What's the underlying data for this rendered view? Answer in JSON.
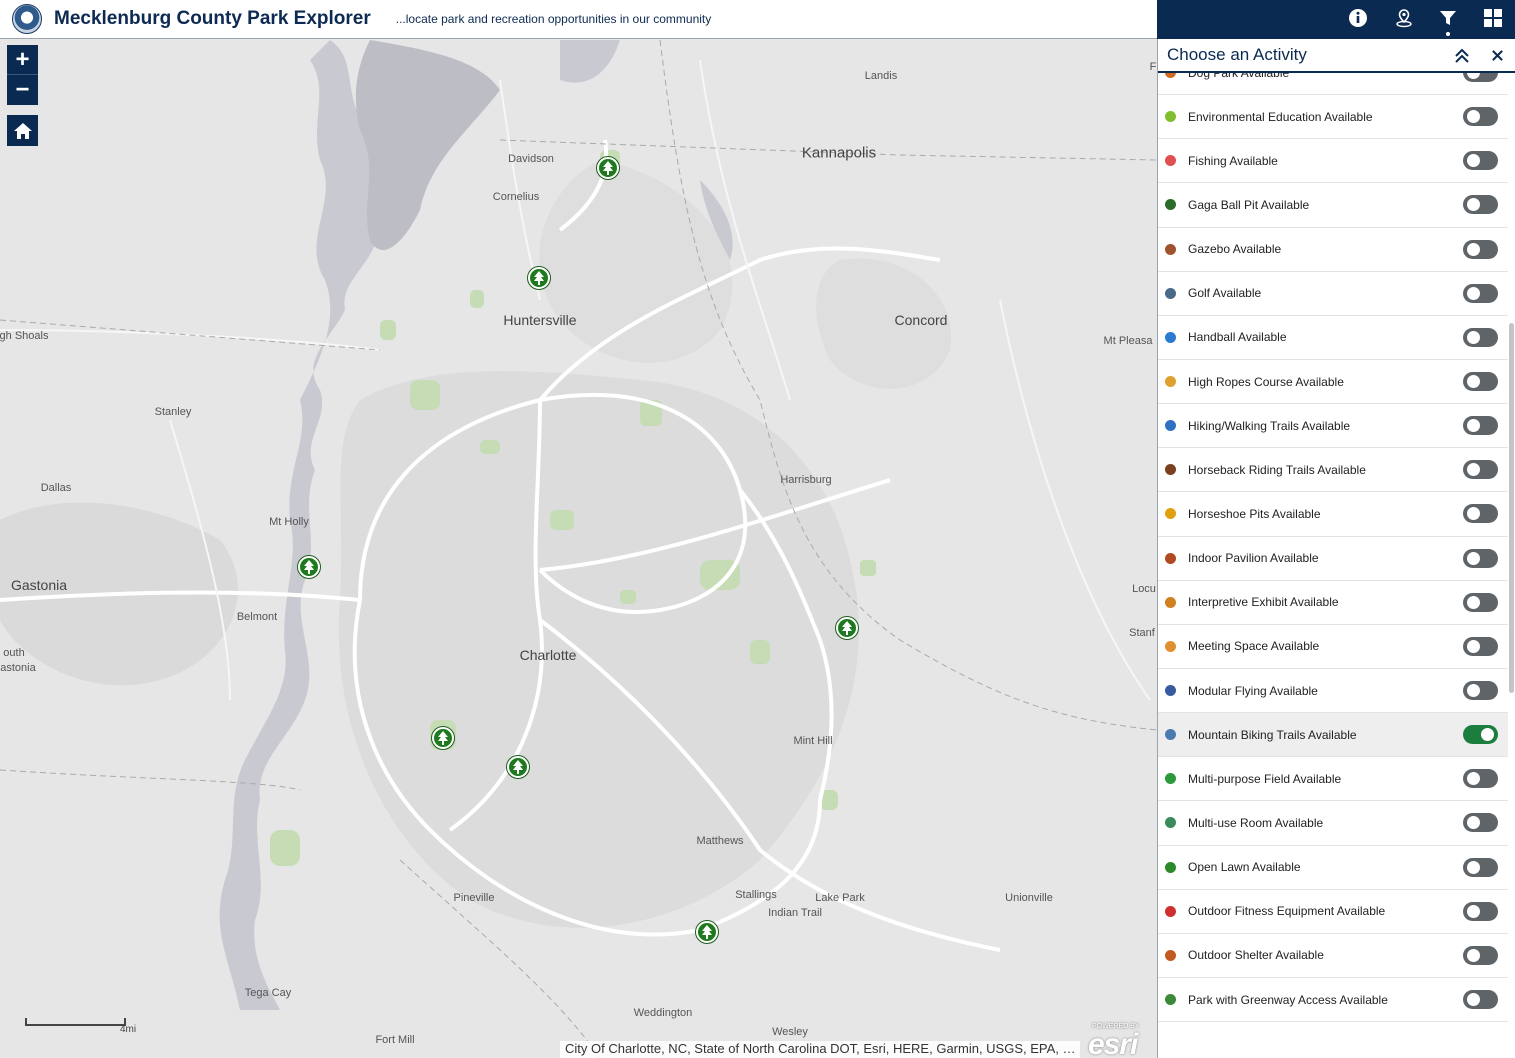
{
  "header": {
    "title": "Mecklenburg County Park Explorer",
    "subtitle": "...locate park and recreation opportunities in our community"
  },
  "toolbar": {
    "icons": [
      "info-icon",
      "location-pin-icon",
      "filter-icon",
      "grid-icon"
    ],
    "active": "filter-icon"
  },
  "map": {
    "zoom_in": "+",
    "zoom_out": "−",
    "scale_label": "4mi",
    "attribution": "City Of Charlotte, NC, State of North Carolina DOT, Esri, HERE, Garmin, USGS, EPA, …",
    "esri_powered": "POWERED BY",
    "esri_text": "esri",
    "labels": {
      "landis": "Landis",
      "kannapolis": "Kannapolis",
      "davidson": "Davidson",
      "cornelius": "Cornelius",
      "huntersville": "Huntersville",
      "concord": "Concord",
      "mt_pleasant": "Mt Pleasa",
      "high_shoals": "gh Shoals",
      "stanley": "Stanley",
      "dallas": "Dallas",
      "harrisburg": "Harrisburg",
      "mt_holly": "Mt Holly",
      "gastonia": "Gastonia",
      "belmont": "Belmont",
      "locust": "Locu",
      "stanfield": "Stanf",
      "south": "outh",
      "south_gastonia": "astonia",
      "charlotte": "Charlotte",
      "mint_hill": "Mint Hill",
      "matthews": "Matthews",
      "stallings": "Stallings",
      "lake_park": "Lake Park",
      "indian_trail": "Indian Trail",
      "unionville": "Unionville",
      "pineville": "Pineville",
      "tega_cay": "Tega Cay",
      "weddington": "Weddington",
      "wesley": "Wesley",
      "fort_mill": "Fort Mill",
      "f_edge": "F"
    }
  },
  "panel": {
    "title": "Choose an Activity",
    "items": [
      {
        "label": "Dog Park Available",
        "icon": "dog-park-icon",
        "color": "#d2691e",
        "on": false
      },
      {
        "label": "Environmental Education Available",
        "icon": "environmental-education-icon",
        "color": "#7fbf2f",
        "on": false
      },
      {
        "label": "Fishing Available",
        "icon": "fishing-icon",
        "color": "#e05050",
        "on": false
      },
      {
        "label": "Gaga Ball Pit Available",
        "icon": "gaga-ball-icon",
        "color": "#2a6b2a",
        "on": false
      },
      {
        "label": "Gazebo Available",
        "icon": "gazebo-icon",
        "color": "#a0522d",
        "on": false
      },
      {
        "label": "Golf Available",
        "icon": "golf-icon",
        "color": "#4a6a8a",
        "on": false
      },
      {
        "label": "Handball Available",
        "icon": "handball-icon",
        "color": "#2a7ad0",
        "on": false
      },
      {
        "label": "High Ropes Course Available",
        "icon": "ropes-course-icon",
        "color": "#e0a030",
        "on": false
      },
      {
        "label": "Hiking/Walking Trails Available",
        "icon": "hiking-icon",
        "color": "#3070c0",
        "on": false
      },
      {
        "label": "Horseback Riding Trails Available",
        "icon": "horse-icon",
        "color": "#7a4020",
        "on": false
      },
      {
        "label": "Horseshoe Pits Available",
        "icon": "horseshoe-icon",
        "color": "#e0a010",
        "on": false
      },
      {
        "label": "Indoor Pavilion Available",
        "icon": "indoor-pavilion-icon",
        "color": "#b04a20",
        "on": false
      },
      {
        "label": "Interpretive Exhibit Available",
        "icon": "exhibit-icon",
        "color": "#d08020",
        "on": false
      },
      {
        "label": "Meeting Space Available",
        "icon": "meeting-space-icon",
        "color": "#e09030",
        "on": false
      },
      {
        "label": "Modular Flying Available",
        "icon": "modular-flying-icon",
        "color": "#3a5aa0",
        "on": false
      },
      {
        "label": "Mountain Biking Trails Available",
        "icon": "mountain-bike-icon",
        "color": "#4a7ab0",
        "on": true
      },
      {
        "label": "Multi-purpose Field Available",
        "icon": "field-icon",
        "color": "#2a9a3a",
        "on": false
      },
      {
        "label": "Multi-use Room Available",
        "icon": "multi-use-room-icon",
        "color": "#3a8a5a",
        "on": false
      },
      {
        "label": "Open Lawn Available",
        "icon": "open-lawn-icon",
        "color": "#2a8a2a",
        "on": false
      },
      {
        "label": "Outdoor Fitness Equipment Available",
        "icon": "fitness-icon",
        "color": "#d03030",
        "on": false
      },
      {
        "label": "Outdoor Shelter Available",
        "icon": "shelter-icon",
        "color": "#c05a20",
        "on": false
      },
      {
        "label": "Park with Greenway Access Available",
        "icon": "greenway-icon",
        "color": "#3a8a3a",
        "on": false
      }
    ]
  },
  "colors": {
    "navy": "#0b2a52",
    "toggle_on": "#1b7e3f",
    "toggle_off": "#5f6468",
    "park_green": "#1f7a1f"
  }
}
